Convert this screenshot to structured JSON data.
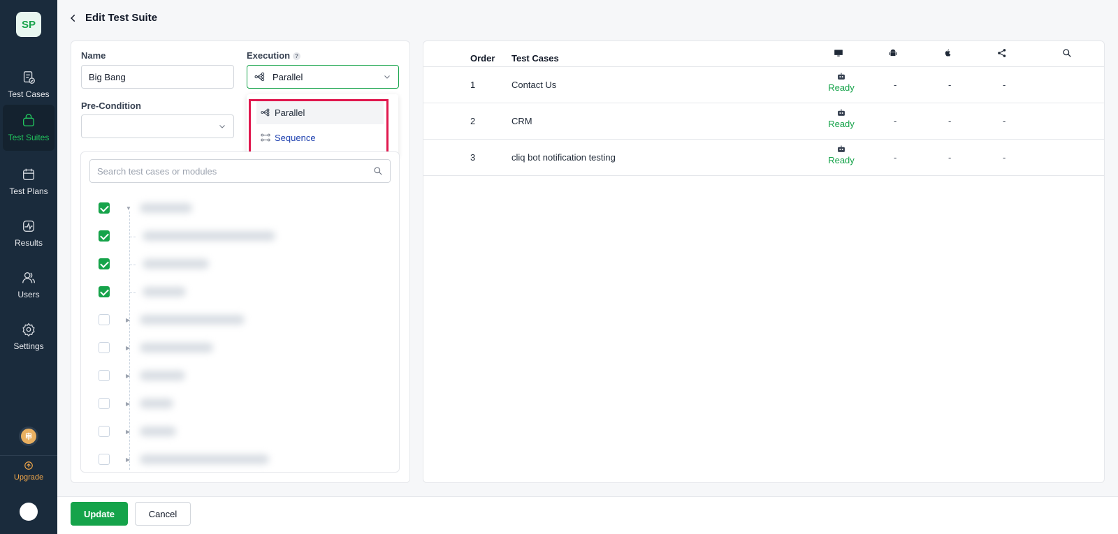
{
  "sidebar": {
    "logo": "SP",
    "items": [
      {
        "label": "Test Cases",
        "icon": "test-cases-icon"
      },
      {
        "label": "Test Suites",
        "icon": "bag-icon",
        "active": true
      },
      {
        "label": "Test Plans",
        "icon": "calendar-icon"
      },
      {
        "label": "Results",
        "icon": "activity-icon"
      },
      {
        "label": "Users",
        "icon": "users-icon"
      },
      {
        "label": "Settings",
        "icon": "gear-icon"
      }
    ],
    "upgrade_label": "Upgrade"
  },
  "header": {
    "title": "Edit Test Suite"
  },
  "form": {
    "name_label": "Name",
    "name_value": "Big Bang",
    "execution_label": "Execution",
    "execution_help": "?",
    "execution_value": "Parallel",
    "precondition_label": "Pre-Condition",
    "precondition_value": "",
    "execution_options": [
      "Parallel",
      "Sequence"
    ]
  },
  "tree": {
    "search_placeholder": "Search test cases or modules",
    "rows": [
      {
        "checked": true
      },
      {
        "checked": true
      },
      {
        "checked": true
      },
      {
        "checked": true
      },
      {
        "checked": false
      },
      {
        "checked": false
      },
      {
        "checked": false
      },
      {
        "checked": false
      },
      {
        "checked": false
      },
      {
        "checked": false
      }
    ]
  },
  "table": {
    "headers": {
      "order": "Order",
      "test_cases": "Test Cases"
    },
    "rows": [
      {
        "order": "1",
        "name": "Contact Us",
        "status": "Ready",
        "android": "-",
        "ios": "-",
        "api": "-"
      },
      {
        "order": "2",
        "name": "CRM",
        "status": "Ready",
        "android": "-",
        "ios": "-",
        "api": "-"
      },
      {
        "order": "3",
        "name": "cliq bot notification testing",
        "status": "Ready",
        "android": "-",
        "ios": "-",
        "api": "-"
      }
    ]
  },
  "footer": {
    "update_label": "Update",
    "cancel_label": "Cancel"
  },
  "colors": {
    "accent": "#16a34a",
    "sidebar": "#1a2b3c",
    "highlight": "#e0184e",
    "upgrade": "#f0a64a"
  }
}
